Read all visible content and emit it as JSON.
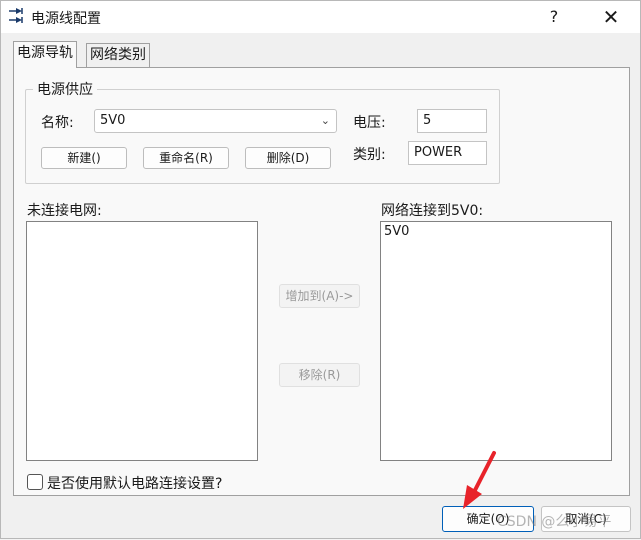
{
  "window": {
    "title": "电源线配置",
    "help_label": "?",
    "close_label": "✕"
  },
  "tabs": [
    {
      "label": "电源导轨",
      "active": true
    },
    {
      "label": "网络类别",
      "active": false
    }
  ],
  "power_supply": {
    "group_title": "电源供应",
    "name_label": "名称:",
    "name_value": "5V0",
    "voltage_label": "电压:",
    "voltage_value": "5",
    "category_label": "类别:",
    "category_value": "POWER",
    "buttons": {
      "new": "新建()",
      "rename": "重命名(R)",
      "delete": "删除(D)"
    }
  },
  "unconnected": {
    "label": "未连接电网:",
    "items": []
  },
  "connected": {
    "label": "网络连接到5V0:",
    "items": [
      "5V0"
    ]
  },
  "transfer": {
    "add_label": "增加到(A)->",
    "remove_label": "移除(R)"
  },
  "default_setting": {
    "label": "是否使用默认电路连接设置?",
    "checked": false
  },
  "footer": {
    "ok_label": "确定(O)",
    "cancel_label": "取消(C)"
  },
  "overlay": {
    "watermark": "CSDN @么小易平",
    "arrow_color": "#e8232a"
  }
}
